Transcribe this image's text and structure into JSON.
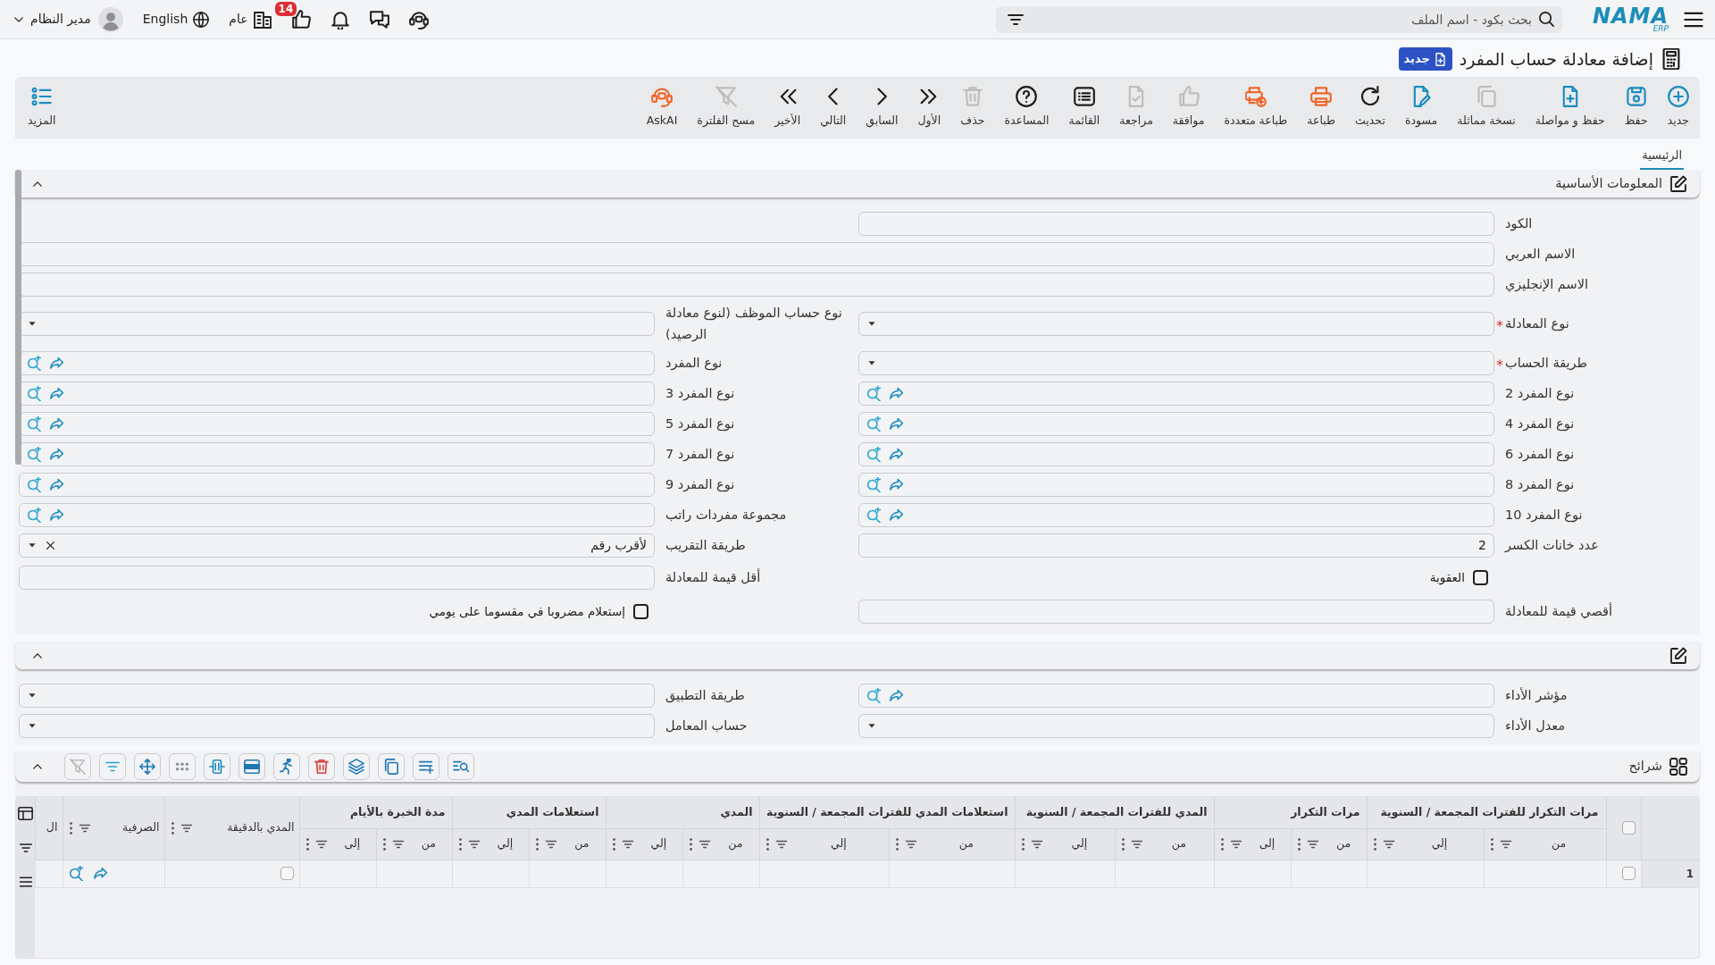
{
  "top_bar": {
    "logo": {
      "name": "NAMA",
      "suffix": "ERP"
    },
    "search": {
      "placeholder": "بحث بكود - اسم الملف"
    },
    "notifications": {
      "count": "14"
    },
    "branch": "عام",
    "language": "English",
    "user": "مدير النظام"
  },
  "header": {
    "title": "إضافة معادلة حساب المفرد",
    "status": "جديد"
  },
  "toolbar": {
    "buttons": [
      {
        "label": "جديد",
        "kind": "new",
        "disabled": false
      },
      {
        "label": "حفظ",
        "kind": "save",
        "disabled": false
      },
      {
        "label": "حفظ و مواصلة",
        "kind": "save-continue",
        "disabled": false
      },
      {
        "label": "نسخة مماثلة",
        "kind": "duplicate",
        "disabled": true
      },
      {
        "label": "مسودة",
        "kind": "draft",
        "disabled": false
      },
      {
        "label": "تحديث",
        "kind": "refresh",
        "disabled": false
      },
      {
        "label": "طباعة",
        "kind": "print",
        "disabled": false
      },
      {
        "label": "طباعة متعددة",
        "kind": "print-multi",
        "disabled": false
      },
      {
        "label": "موافقة",
        "kind": "approve",
        "disabled": true
      },
      {
        "label": "مراجعة",
        "kind": "review",
        "disabled": true
      },
      {
        "label": "القائمة",
        "kind": "list",
        "disabled": false
      },
      {
        "label": "المساعدة",
        "kind": "help",
        "disabled": false
      },
      {
        "label": "حذف",
        "kind": "delete",
        "disabled": true
      },
      {
        "label": "الأول",
        "kind": "first",
        "disabled": false
      },
      {
        "label": "السابق",
        "kind": "previous",
        "disabled": false
      },
      {
        "label": "التالي",
        "kind": "next",
        "disabled": false
      },
      {
        "label": "الأخير",
        "kind": "last",
        "disabled": false
      },
      {
        "label": "مسح الفلترة",
        "kind": "clear-filter",
        "disabled": true
      },
      {
        "label": "AskAI",
        "kind": "ask-ai",
        "disabled": false
      }
    ],
    "more": {
      "label": "المزيد"
    }
  },
  "tabs": [
    {
      "label": "الرئيسية",
      "selected": true
    }
  ],
  "sections": [
    {
      "title": "المعلومات الأساسية",
      "expanded": true,
      "rows": [
        {
          "kind": "pair",
          "fields": [
            {
              "label": "الكود",
              "kind": "text",
              "required": false
            }
          ]
        },
        {
          "kind": "wide",
          "fields": [
            {
              "label": "الاسم العربي",
              "kind": "text",
              "required": false
            }
          ]
        },
        {
          "kind": "wide",
          "fields": [
            {
              "label": "الاسم الإنجليزي",
              "kind": "text",
              "required": false
            }
          ]
        },
        {
          "kind": "pair",
          "fields": [
            {
              "label": "نوع المعادلة",
              "kind": "select",
              "required": true
            },
            {
              "label": "نوع حساب الموظف (لنوع معادلة الرصيد)",
              "kind": "select",
              "required": false
            }
          ]
        },
        {
          "kind": "pair",
          "fields": [
            {
              "label": "طريقة الحساب",
              "kind": "select",
              "required": true
            },
            {
              "label": "نوع المفرد",
              "kind": "lookup",
              "required": false
            }
          ]
        },
        {
          "kind": "pair",
          "fields": [
            {
              "label": "نوع المفرد 2",
              "kind": "lookup",
              "required": false
            },
            {
              "label": "نوع المفرد 3",
              "kind": "lookup",
              "required": false
            }
          ]
        },
        {
          "kind": "pair",
          "fields": [
            {
              "label": "نوع المفرد 4",
              "kind": "lookup",
              "required": false
            },
            {
              "label": "نوع المفرد 5",
              "kind": "lookup",
              "required": false
            }
          ]
        },
        {
          "kind": "pair",
          "fields": [
            {
              "label": "نوع المفرد 6",
              "kind": "lookup",
              "required": false
            },
            {
              "label": "نوع المفرد 7",
              "kind": "lookup",
              "required": false
            }
          ]
        },
        {
          "kind": "pair",
          "fields": [
            {
              "label": "نوع المفرد 8",
              "kind": "lookup",
              "required": false
            },
            {
              "label": "نوع المفرد 9",
              "kind": "lookup",
              "required": false
            }
          ]
        },
        {
          "kind": "pair",
          "fields": [
            {
              "label": "نوع المفرد 10",
              "kind": "lookup",
              "required": false
            },
            {
              "label": "مجموعة مفردات راتب",
              "kind": "lookup",
              "required": false
            }
          ]
        },
        {
          "kind": "pair",
          "fields": [
            {
              "label": "عدد خانات الكسر",
              "kind": "text",
              "required": false,
              "value": "2"
            },
            {
              "label": "طريقة التقريب",
              "kind": "select",
              "required": false,
              "value": "لأقرب رقم"
            }
          ]
        },
        {
          "kind": "pair",
          "fields": [
            {
              "label": "العقوبة",
              "kind": "checkbox",
              "checked": false
            },
            {
              "label": "أقل قيمة للمعادلة",
              "kind": "text",
              "required": false
            }
          ]
        },
        {
          "kind": "pair",
          "fields": [
            {
              "label": "أقصي قيمة للمعادلة",
              "kind": "text",
              "required": false
            },
            {
              "label": "إستعلام مضروبا في مقسوما على يومي",
              "kind": "checkbox",
              "checked": false
            }
          ]
        }
      ]
    },
    {
      "expanded": true,
      "rows": [
        {
          "kind": "pair",
          "fields": [
            {
              "label": "مؤشر الأداء",
              "kind": "lookup",
              "required": false
            },
            {
              "label": "طريقة التطبيق",
              "kind": "select",
              "required": false
            }
          ]
        },
        {
          "kind": "pair",
          "fields": [
            {
              "label": "معدل الأداء",
              "kind": "select",
              "required": false
            },
            {
              "label": "حساب المعامل",
              "kind": "select",
              "required": false
            }
          ]
        }
      ]
    }
  ],
  "grid": {
    "title": "شرائح",
    "expanded": true,
    "tools": [
      {
        "kind": "find",
        "disabled": false
      },
      {
        "kind": "add-row",
        "disabled": false
      },
      {
        "kind": "copy",
        "disabled": false
      },
      {
        "kind": "layers",
        "disabled": false
      },
      {
        "kind": "delete",
        "disabled": false
      },
      {
        "kind": "run",
        "disabled": false
      },
      {
        "kind": "merge",
        "disabled": false
      },
      {
        "kind": "resize",
        "disabled": false
      },
      {
        "kind": "dots",
        "disabled": false
      },
      {
        "kind": "move",
        "disabled": false
      },
      {
        "kind": "filter",
        "disabled": false
      },
      {
        "kind": "clear-filter",
        "disabled": true
      }
    ],
    "select_all": {
      "checked": false
    },
    "columns": [
      {
        "title": "مرات التكرار للفترات المجمعة / السنوية",
        "children": [
          {
            "title": "من",
            "filterable": true
          },
          {
            "title": "إلي",
            "filterable": true
          }
        ]
      },
      {
        "title": "مرات التكرار",
        "children": [
          {
            "title": "من",
            "filterable": true
          },
          {
            "title": "إلى",
            "filterable": true
          }
        ]
      },
      {
        "title": "المدي للفترات المجمعة / السنوية",
        "children": [
          {
            "title": "من",
            "filterable": true
          },
          {
            "title": "إلي",
            "filterable": true
          }
        ]
      },
      {
        "title": "استعلامات المدي للفترات المجمعة / السنوية",
        "children": [
          {
            "title": "من",
            "filterable": true
          },
          {
            "title": "إلي",
            "filterable": true
          }
        ]
      },
      {
        "title": "المدي",
        "children": [
          {
            "title": "من",
            "filterable": true
          },
          {
            "title": "إلي",
            "filterable": true
          }
        ]
      },
      {
        "title": "استعلامات المدي",
        "children": [
          {
            "title": "من",
            "filterable": true
          },
          {
            "title": "إلي",
            "filterable": true
          }
        ]
      },
      {
        "title": "مدة الخبرة بالأيام",
        "children": [
          {
            "title": "من",
            "filterable": true
          },
          {
            "title": "إلى",
            "filterable": true
          }
        ]
      },
      {
        "title": "المدي بالدقيقة",
        "kind": "checkbox",
        "filterable": true
      },
      {
        "title": "الصرفية",
        "kind": "lookup",
        "filterable": true
      },
      {
        "title": "ال",
        "filterable": false
      }
    ],
    "rows": [
      {
        "number": "1",
        "selected": false,
        "checked": false
      }
    ]
  }
}
